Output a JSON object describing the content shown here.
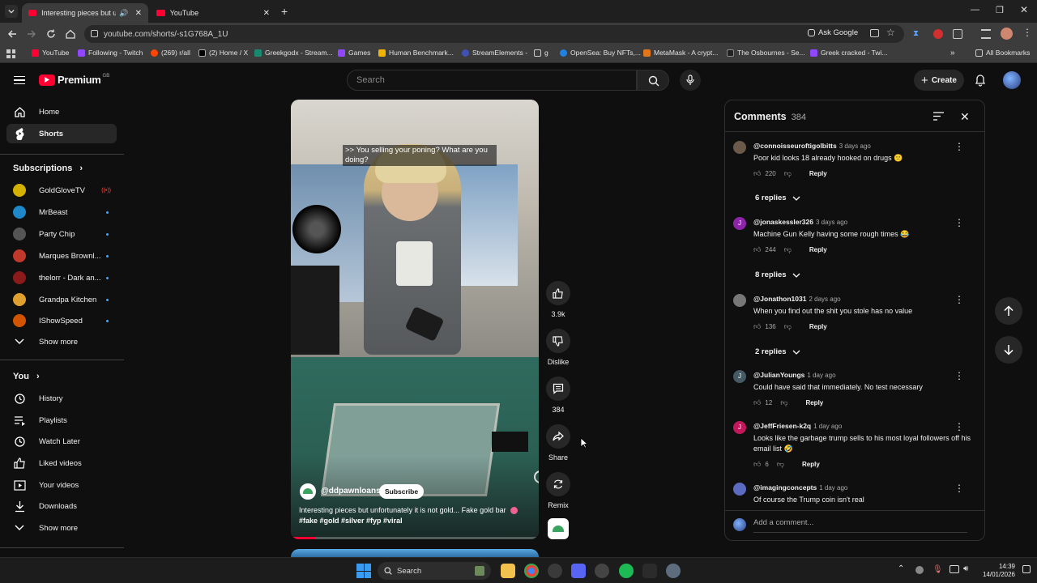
{
  "browser": {
    "tabs": [
      {
        "title": "Interesting pieces but unfo",
        "active": true
      },
      {
        "title": "YouTube",
        "active": false
      }
    ],
    "url": "youtube.com/shorts/-s1G768A_1U",
    "ask_google": "Ask Google",
    "bookmarks": [
      "YouTube",
      "Following - Twitch",
      "(269) r/all",
      "(2) Home / X",
      "Greekgodx - Stream...",
      "Games",
      "Human Benchmark...",
      "StreamElements -",
      "g",
      "OpenSea: Buy NFTs,...",
      "MetaMask - A crypt...",
      "The Osbournes - Se...",
      "Greek cracked - Twi..."
    ],
    "all_bookmarks": "All Bookmarks"
  },
  "masthead": {
    "logo": "Premium",
    "region": "GB",
    "search_placeholder": "Search",
    "create": "Create"
  },
  "sidebar": {
    "main": [
      {
        "label": "Home",
        "icon": "home-icon"
      },
      {
        "label": "Shorts",
        "icon": "shorts-icon",
        "active": true
      }
    ],
    "subscriptions_title": "Subscriptions",
    "subscriptions": [
      {
        "label": "GoldGloveTV",
        "color": "#d4b000",
        "live": true
      },
      {
        "label": "MrBeast",
        "color": "#1e88c8"
      },
      {
        "label": "Party Chip",
        "color": "#555555"
      },
      {
        "label": "Marques Brownl...",
        "color": "#c0392b"
      },
      {
        "label": "thelorr - Dark an...",
        "color": "#8b1a1a"
      },
      {
        "label": "Grandpa Kitchen",
        "color": "#e0a030"
      },
      {
        "label": "IShowSpeed",
        "color": "#d35400"
      }
    ],
    "show_more_1": "Show more",
    "you_title": "You",
    "you": [
      {
        "label": "History",
        "icon": "history-icon"
      },
      {
        "label": "Playlists",
        "icon": "playlists-icon"
      },
      {
        "label": "Watch Later",
        "icon": "watch-later-icon"
      },
      {
        "label": "Liked videos",
        "icon": "like-icon"
      },
      {
        "label": "Your videos",
        "icon": "your-videos-icon"
      },
      {
        "label": "Downloads",
        "icon": "download-icon"
      }
    ],
    "show_more_2": "Show more"
  },
  "short": {
    "caption": ">> You selling your poning? What are you doing?",
    "channel": "@ddpawnloans",
    "subscribe": "Subscribe",
    "description": "Interesting pieces but unfortunately it is not gold... Fake gold bar",
    "hashtags": "#fake #gold #silver #fyp #viral",
    "progress": 0.1
  },
  "actions": {
    "likes": "3.9k",
    "dislike": "Dislike",
    "comments": "384",
    "share": "Share",
    "remix": "Remix"
  },
  "comments_panel": {
    "title": "Comments",
    "count": "384",
    "add_placeholder": "Add a comment...",
    "items": [
      {
        "user": "@connoisseuroftigolbitts",
        "time": "3 days ago",
        "text": "Poor kid looks 18 already hooked on drugs 😕",
        "likes": "220",
        "reply": "Reply",
        "replies": "6 replies",
        "color": "#6b5a4a"
      },
      {
        "user": "@jonaskessler326",
        "time": "3 days ago",
        "text": "Machine Gun Kelly having some rough times 😂",
        "likes": "244",
        "reply": "Reply",
        "replies": "8 replies",
        "color": "#8e24aa",
        "initial": "J"
      },
      {
        "user": "@Jonathon1031",
        "time": "2 days ago",
        "text": "When you find out the shit you stole has no value",
        "likes": "136",
        "reply": "Reply",
        "replies": "2 replies",
        "color": "#777777"
      },
      {
        "user": "@JulianYoungs",
        "time": "1 day ago",
        "text": "Could have said that immediately. No test necessary",
        "likes": "12",
        "reply": "Reply",
        "color": "#455a64",
        "initial": "J"
      },
      {
        "user": "@JeffFriesen-k2q",
        "time": "1 day ago",
        "text": "Looks like the garbage trump sells to his most loyal followers off his email list 🤣",
        "likes": "6",
        "reply": "Reply",
        "color": "#c2185b",
        "initial": "J"
      },
      {
        "user": "@imagingconcepts",
        "time": "1 day ago",
        "text": "Of course the Trump coin isn't real",
        "color": "#5c6bc0"
      }
    ]
  },
  "taskbar": {
    "search": "Search",
    "time": "14:39",
    "date": "14/01/2026"
  }
}
